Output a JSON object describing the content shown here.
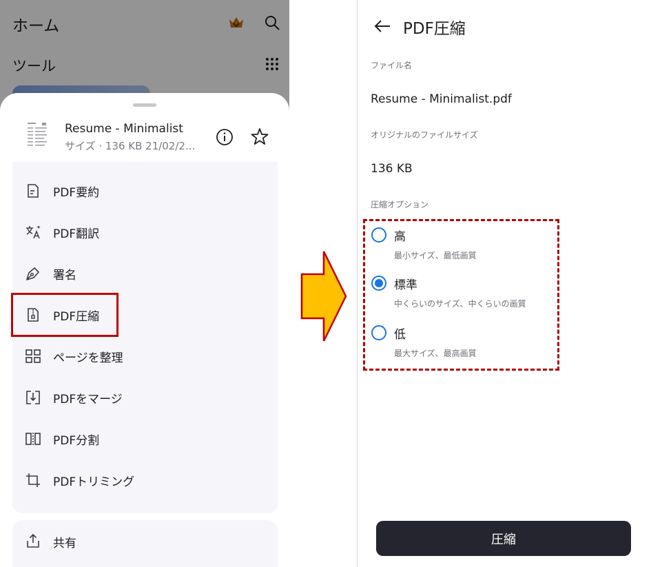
{
  "home": {
    "title": "ホーム",
    "tools_label": "ツール",
    "icons": [
      "crown-icon",
      "search-icon",
      "grid-icon"
    ]
  },
  "sheet": {
    "file_name": "Resume - Minimalist",
    "file_meta": "サイズ · 136 KB 21/02/2...",
    "icons": [
      "info-icon",
      "star-icon"
    ],
    "menu_items": [
      {
        "label": "PDF要約",
        "icon": "doc-summary-icon"
      },
      {
        "label": "PDF翻訳",
        "icon": "translate-icon"
      },
      {
        "label": "署名",
        "icon": "pen-icon"
      },
      {
        "label": "PDF圧縮",
        "icon": "zip-file-icon"
      },
      {
        "label": "ページを整理",
        "icon": "pages-grid-icon"
      },
      {
        "label": "PDFをマージ",
        "icon": "merge-icon"
      },
      {
        "label": "PDF分割",
        "icon": "split-icon"
      },
      {
        "label": "PDFトリミング",
        "icon": "crop-icon"
      }
    ],
    "share": {
      "label": "共有",
      "icon": "share-icon"
    },
    "highlight_color": "#c00000"
  },
  "compress_screen": {
    "title": "PDF圧縮",
    "file_name_label": "ファイル名",
    "file_name_value": "Resume - Minimalist.pdf",
    "original_size_label": "オリジナルのファイルサイズ",
    "original_size_value": "136 KB",
    "options_label": "圧縮オプション",
    "options": [
      {
        "title": "高",
        "desc": "最小サイズ、最低画質",
        "selected": false
      },
      {
        "title": "標準",
        "desc": "中くらいのサイズ、中くらいの画質",
        "selected": true
      },
      {
        "title": "低",
        "desc": "最大サイズ、最高画質",
        "selected": false
      }
    ],
    "button_label": "圧縮",
    "accent_color": "#1a73e8",
    "button_color": "#24252f"
  },
  "arrow": {
    "fill": "#ffc000",
    "stroke": "#c00000"
  }
}
